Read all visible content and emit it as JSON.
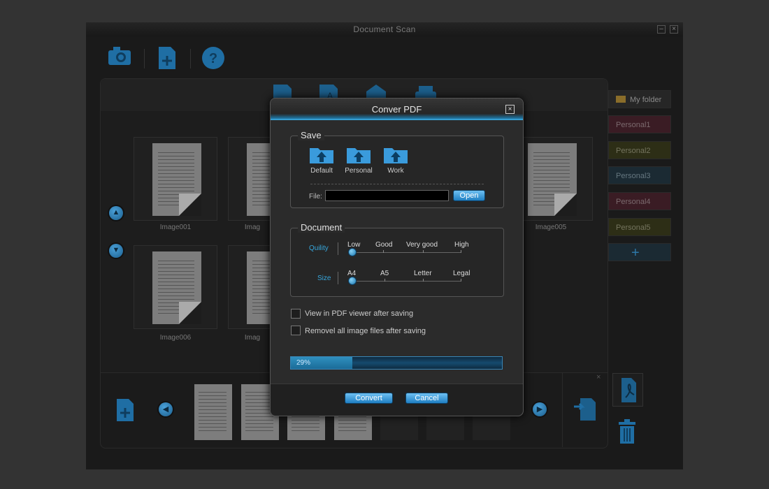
{
  "window": {
    "title": "Document Scan"
  },
  "workspace": {
    "thumbnails": [
      {
        "label": "Image001"
      },
      {
        "label": "Imag"
      },
      {
        "label": "Image005"
      },
      {
        "label": "Image006"
      },
      {
        "label": "Imag"
      }
    ]
  },
  "folders": {
    "items": [
      {
        "label": "My folder",
        "color": "#333333"
      },
      {
        "label": "Personal1",
        "color": "#5a1f2d"
      },
      {
        "label": "Personal2",
        "color": "#3b3d16"
      },
      {
        "label": "Personal3",
        "color": "#1e3442"
      },
      {
        "label": "Personal4",
        "color": "#5a1f2d"
      },
      {
        "label": "Personal5",
        "color": "#3b3d16"
      }
    ],
    "add_symbol": "+"
  },
  "dialog": {
    "title": "Conver PDF",
    "close_symbol": "×",
    "save": {
      "title": "Save",
      "buttons": [
        {
          "label": "Default"
        },
        {
          "label": "Personal"
        },
        {
          "label": "Work"
        }
      ],
      "file_label": "File:",
      "file_value": "",
      "open_label": "Open"
    },
    "document": {
      "title": "Document",
      "quality": {
        "label": "Quility",
        "options": [
          "Low",
          "Good",
          "Very good",
          "High"
        ],
        "selected": "Low"
      },
      "size": {
        "label": "Size",
        "options": [
          "A4",
          "A5",
          "Letter",
          "Legal"
        ],
        "selected": "A4"
      }
    },
    "options": {
      "view_pdf": {
        "label": "View in  PDF viewer after saving",
        "checked": false
      },
      "remove_images": {
        "label": "Removel all image files after saving",
        "checked": false
      }
    },
    "progress": {
      "text": "29%",
      "value": 0.29
    },
    "convert_label": "Convert",
    "cancel_label": "Cancel"
  },
  "colors": {
    "accent": "#2a96d4",
    "background": "#1a1a1a"
  }
}
